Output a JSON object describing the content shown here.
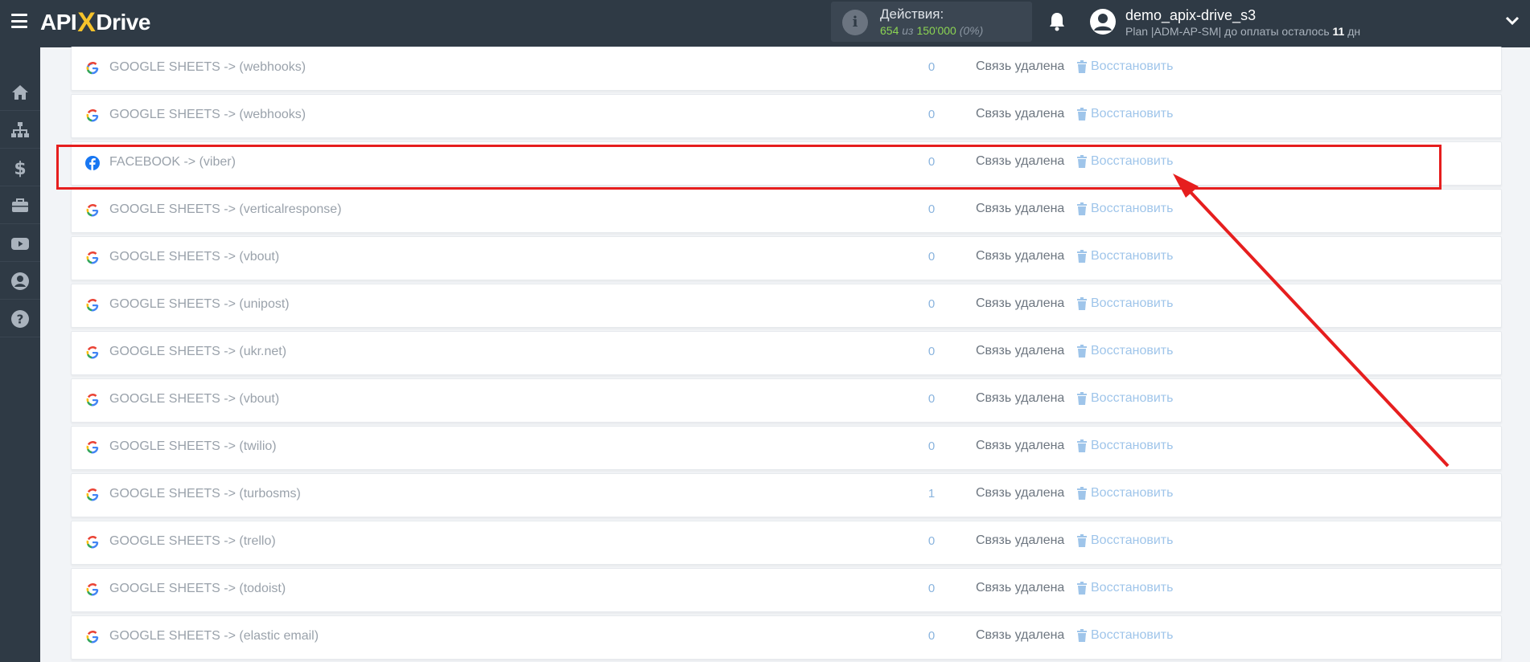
{
  "header": {
    "logo": {
      "pre": "API",
      "x": "X",
      "post": "Drive"
    },
    "actions_label": "Действия:",
    "actions_used": "654",
    "actions_sep": " из ",
    "actions_total": "150'000",
    "actions_pct": " (0%)",
    "username": "demo_apix-drive_s3",
    "plan_prefix": "Plan |ADM-AP-SM| до оплаты осталось ",
    "plan_days": "11",
    "plan_suffix": " дн"
  },
  "sidebar": {
    "items": [
      {
        "icon": "home-icon"
      },
      {
        "icon": "sitemap-icon"
      },
      {
        "icon": "dollar-icon"
      },
      {
        "icon": "briefcase-icon"
      },
      {
        "icon": "youtube-icon"
      },
      {
        "icon": "user-circle-icon"
      },
      {
        "icon": "help-icon"
      }
    ]
  },
  "rows": [
    {
      "icon": "google-icon",
      "name": "GOOGLE SHEETS -> (webhooks)",
      "count": "0",
      "status": "Связь удалена",
      "action": "Восстановить"
    },
    {
      "icon": "google-icon",
      "name": "GOOGLE SHEETS -> (webhooks)",
      "count": "0",
      "status": "Связь удалена",
      "action": "Восстановить"
    },
    {
      "icon": "facebook-icon",
      "name": "FACEBOOK -> (viber)",
      "count": "0",
      "status": "Связь удалена",
      "action": "Восстановить"
    },
    {
      "icon": "google-icon",
      "name": "GOOGLE SHEETS -> (verticalresponse)",
      "count": "0",
      "status": "Связь удалена",
      "action": "Восстановить"
    },
    {
      "icon": "google-icon",
      "name": "GOOGLE SHEETS -> (vbout)",
      "count": "0",
      "status": "Связь удалена",
      "action": "Восстановить"
    },
    {
      "icon": "google-icon",
      "name": "GOOGLE SHEETS -> (unipost)",
      "count": "0",
      "status": "Связь удалена",
      "action": "Восстановить"
    },
    {
      "icon": "google-icon",
      "name": "GOOGLE SHEETS -> (ukr.net)",
      "count": "0",
      "status": "Связь удалена",
      "action": "Восстановить"
    },
    {
      "icon": "google-icon",
      "name": "GOOGLE SHEETS -> (vbout)",
      "count": "0",
      "status": "Связь удалена",
      "action": "Восстановить"
    },
    {
      "icon": "google-icon",
      "name": "GOOGLE SHEETS -> (twilio)",
      "count": "0",
      "status": "Связь удалена",
      "action": "Восстановить"
    },
    {
      "icon": "google-icon",
      "name": "GOOGLE SHEETS -> (turbosms)",
      "count": "1",
      "status": "Связь удалена",
      "action": "Восстановить"
    },
    {
      "icon": "google-icon",
      "name": "GOOGLE SHEETS -> (trello)",
      "count": "0",
      "status": "Связь удалена",
      "action": "Восстановить"
    },
    {
      "icon": "google-icon",
      "name": "GOOGLE SHEETS -> (todoist)",
      "count": "0",
      "status": "Связь удалена",
      "action": "Восстановить"
    },
    {
      "icon": "google-icon",
      "name": "GOOGLE SHEETS -> (elastic email)",
      "count": "0",
      "status": "Связь удалена",
      "action": "Восстановить"
    }
  ],
  "colors": {
    "topbar": "#2f3a45",
    "accent": "#f6c32b",
    "restore": "#9fc5ea",
    "highlight": "#e61e1e"
  }
}
